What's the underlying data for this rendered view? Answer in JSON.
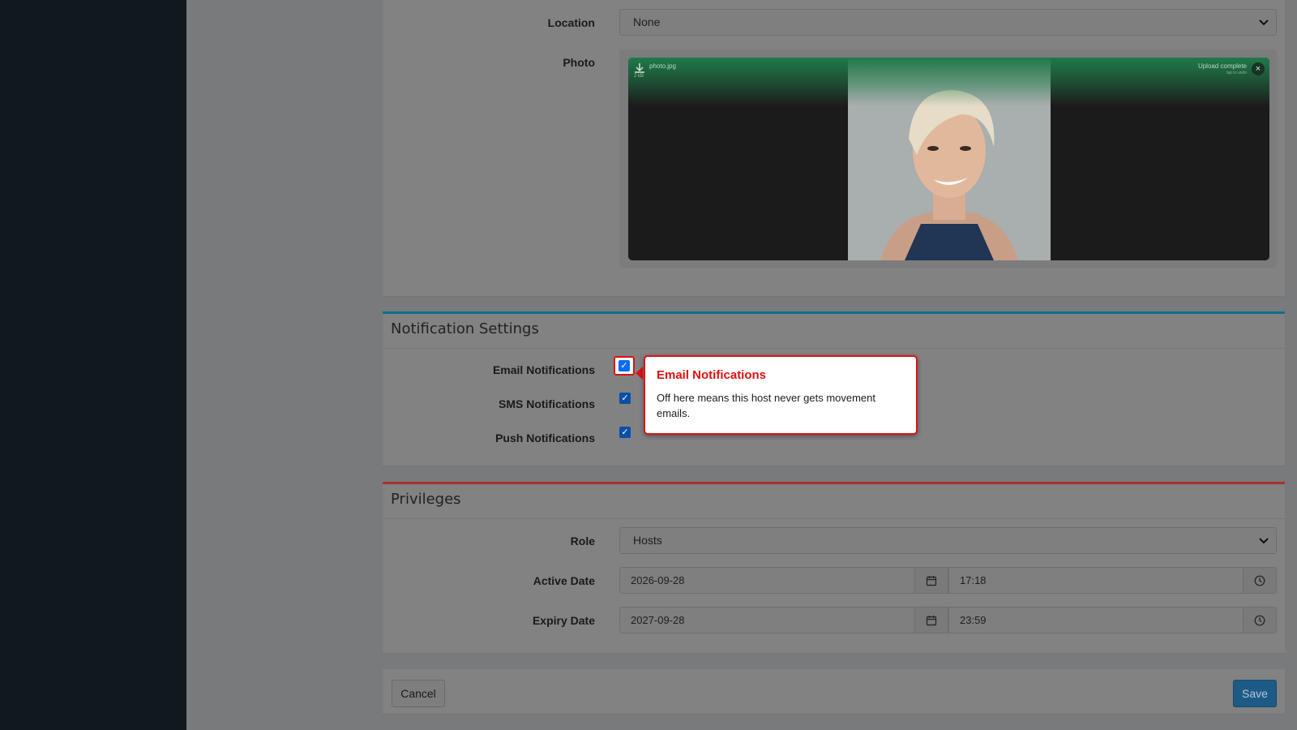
{
  "form": {
    "location": {
      "label": "Location",
      "value": "None"
    },
    "photo": {
      "label": "Photo",
      "file_name": "photo.jpg",
      "file_size": "2 kB",
      "status": "Upload complete",
      "status_hint": "tap to undo"
    }
  },
  "notification_settings": {
    "title": "Notification Settings",
    "email": {
      "label": "Email Notifications",
      "checked": true
    },
    "sms": {
      "label": "SMS Notifications",
      "checked": true
    },
    "push": {
      "label": "Push Notifications",
      "checked": true
    }
  },
  "tooltip": {
    "title": "Email Notifications",
    "body": "Off here means this host never gets movement emails."
  },
  "privileges": {
    "title": "Privileges",
    "role": {
      "label": "Role",
      "value": "Hosts"
    },
    "active_date": {
      "label": "Active Date",
      "date": "2026-09-28",
      "time": "17:18"
    },
    "expiry_date": {
      "label": "Expiry Date",
      "date": "2027-09-28",
      "time": "23:59"
    }
  },
  "footer": {
    "cancel_label": "Cancel",
    "save_label": "Save"
  },
  "colors": {
    "sidebar": "#101820",
    "highlight": "#e01010",
    "notif_accent": "#0f6d8f",
    "privileges_accent": "#a8322b",
    "save_button": "#1e5a86"
  }
}
